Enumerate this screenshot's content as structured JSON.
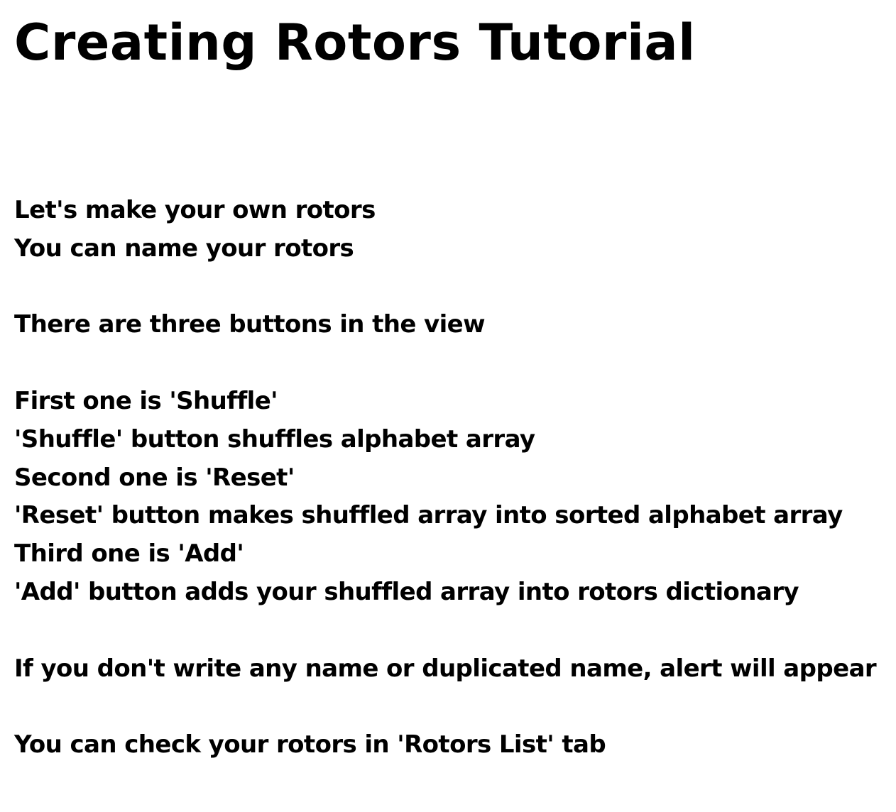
{
  "page": {
    "title": "Creating Rotors Tutorial",
    "lines": [
      "Let's make your own rotors",
      "You can name your rotors",
      "",
      "There are three buttons in the view",
      "",
      "First one is 'Shuffle'",
      "'Shuffle' button shuffles alphabet array",
      "Second one is 'Reset'",
      "'Reset' button makes shuffled array into sorted alphabet array",
      "Third one is 'Add'",
      "'Add' button adds your shuffled array into rotors dictionary",
      "",
      "If you don't write any name or duplicated name, alert will appear",
      "",
      "You can check your rotors in 'Rotors List' tab"
    ]
  },
  "colors": {
    "background": "#ffffff",
    "text": "#000000"
  }
}
